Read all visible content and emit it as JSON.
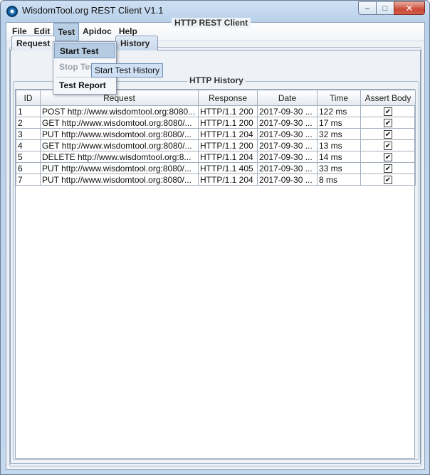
{
  "window": {
    "title": "WisdomTool.org REST Client V1.1"
  },
  "menubar": {
    "items": [
      "File",
      "Edit",
      "Test",
      "Apidoc",
      "Help"
    ],
    "active": "Test"
  },
  "test_menu": {
    "items": [
      "Start Test",
      "Stop Test",
      "Test Report"
    ],
    "highlighted": "Start Test",
    "disabled": "Stop Test"
  },
  "tooltip": {
    "text": "Start Test History"
  },
  "main_panel": {
    "title": "HTTP REST Client"
  },
  "tabs": {
    "request": "Request",
    "history": "History"
  },
  "history_group": {
    "title": "HTTP History"
  },
  "table": {
    "columns": [
      "ID",
      "Request",
      "Response",
      "Date",
      "Time",
      "Assert Body"
    ],
    "rows": [
      {
        "id": "1",
        "request": "POST http://www.wisdomtool.org:8080...",
        "response": "HTTP/1.1 200",
        "date": "2017-09-30 ...",
        "time": "122 ms",
        "assert": true
      },
      {
        "id": "2",
        "request": "GET http://www.wisdomtool.org:8080/...",
        "response": "HTTP/1.1 200",
        "date": "2017-09-30 ...",
        "time": "17 ms",
        "assert": true
      },
      {
        "id": "3",
        "request": "PUT http://www.wisdomtool.org:8080/...",
        "response": "HTTP/1.1 204",
        "date": "2017-09-30 ...",
        "time": "32 ms",
        "assert": true
      },
      {
        "id": "4",
        "request": "GET http://www.wisdomtool.org:8080/...",
        "response": "HTTP/1.1 200",
        "date": "2017-09-30 ...",
        "time": "13 ms",
        "assert": true
      },
      {
        "id": "5",
        "request": "DELETE http://www.wisdomtool.org:8...",
        "response": "HTTP/1.1 204",
        "date": "2017-09-30 ...",
        "time": "14 ms",
        "assert": true
      },
      {
        "id": "6",
        "request": "PUT http://www.wisdomtool.org:8080/...",
        "response": "HTTP/1.1 405",
        "date": "2017-09-30 ...",
        "time": "33 ms",
        "assert": true
      },
      {
        "id": "7",
        "request": "PUT http://www.wisdomtool.org:8080/...",
        "response": "HTTP/1.1 204",
        "date": "2017-09-30 ...",
        "time": "8 ms",
        "assert": true
      }
    ]
  },
  "icons": {
    "app": "app-globe-icon",
    "minimize": "minimize-icon",
    "maximize": "maximize-icon",
    "close": "close-icon",
    "check": "checkmark-icon"
  },
  "colors": {
    "titlebar": "#c4d8ee",
    "menu_highlight": "#b4cbe2",
    "close_button": "#c94a36",
    "tooltip_bg": "#cfe0f5"
  }
}
